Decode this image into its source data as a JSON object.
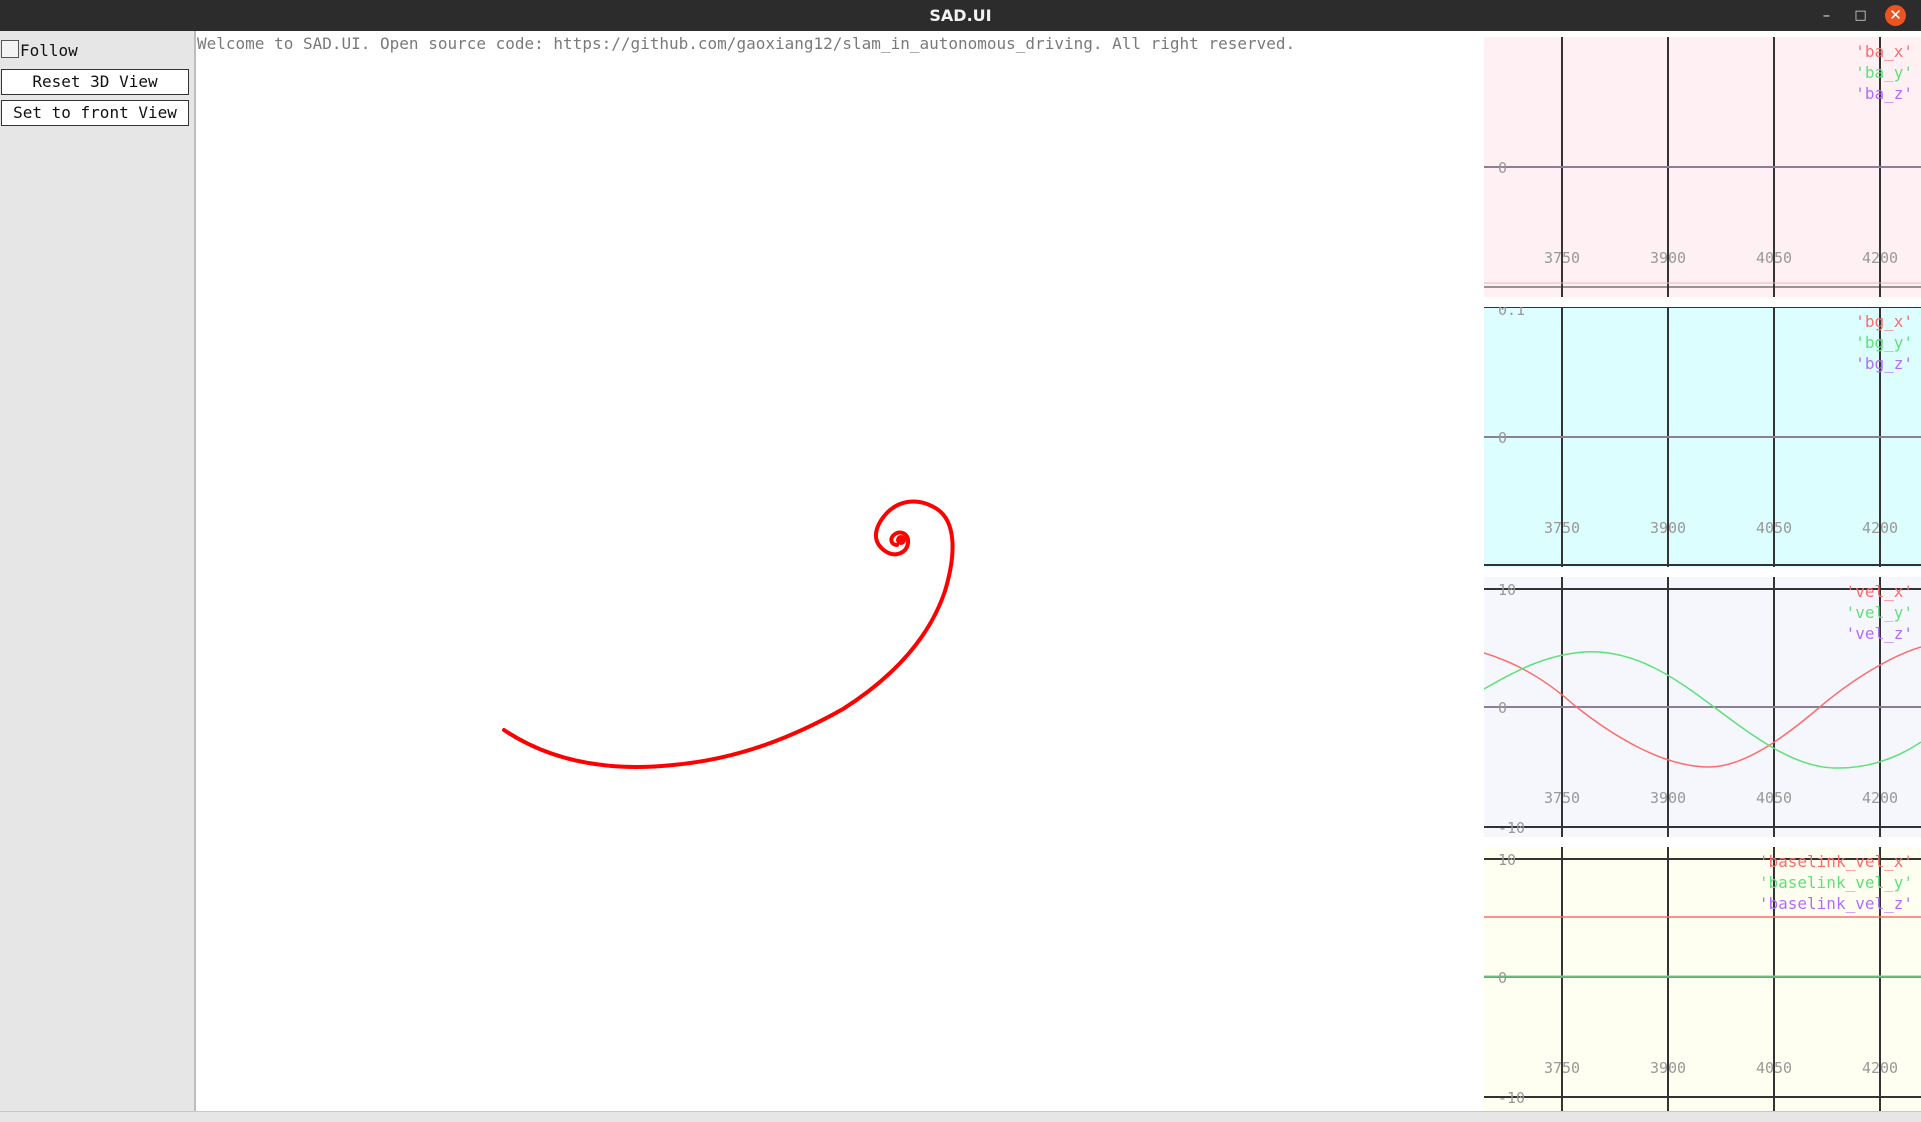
{
  "window": {
    "title": "SAD.UI",
    "minimize_glyph": "–",
    "maximize_glyph": "□",
    "close_glyph": "✕"
  },
  "panel": {
    "follow_label": "Follow",
    "follow_checked": false,
    "reset_label": "Reset 3D View",
    "front_label": "Set to front View"
  },
  "welcome_text": "Welcome to SAD.UI. Open source code: https://github.com/gaoxiang12/slam_in_autonomous_driving. All right reserved.",
  "trajectory": {
    "color": "#ff0000",
    "shape": "spiral"
  },
  "colors": {
    "x": "#ff6b6b",
    "y": "#5fe07a",
    "z": "#b36bff"
  },
  "plots": [
    {
      "id": "ba",
      "background": "#fff0f4",
      "legend": [
        "'ba_x'",
        "'ba_y'",
        "'ba_z'"
      ],
      "y_labels": [
        "0"
      ],
      "x_ticks": [
        "3750",
        "3900",
        "4050",
        "4200"
      ]
    },
    {
      "id": "bg",
      "background": "#dcfefe",
      "legend": [
        "'bg_x'",
        "'bg_y'",
        "'bg_z'"
      ],
      "y_labels": [
        "0.1",
        "0"
      ],
      "x_ticks": [
        "3750",
        "3900",
        "4050",
        "4200"
      ]
    },
    {
      "id": "vel",
      "background": "#f5f7fc",
      "legend": [
        "'vel_x'",
        "'vel_y'",
        "'vel_z'"
      ],
      "y_labels": [
        "10",
        "0",
        "-10"
      ],
      "x_ticks": [
        "3750",
        "3900",
        "4050",
        "4200"
      ]
    },
    {
      "id": "baselink",
      "background": "#fefff0",
      "legend": [
        "'baselink_vel_x'",
        "'baselink_vel_y'",
        "'baselink_vel_z'"
      ],
      "y_labels": [
        "10",
        "0",
        "-10"
      ],
      "x_ticks": [
        "3750",
        "3900",
        "4050",
        "4200"
      ]
    }
  ]
}
